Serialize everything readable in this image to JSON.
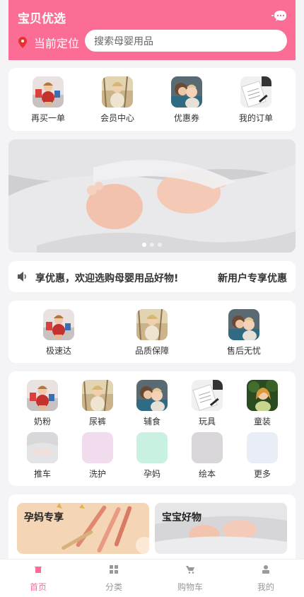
{
  "header": {
    "title": "宝贝优选",
    "location_label": "当前定位",
    "search_placeholder": "搜索母婴用品",
    "message_icon": "chat-bubble-icon",
    "location_icon": "location-pin-icon",
    "color": "#fc6d96"
  },
  "quick_links": [
    {
      "label": "再买一单",
      "icon": "photo-baby-play-icon"
    },
    {
      "label": "会员中心",
      "icon": "photo-child-outdoor-icon"
    },
    {
      "label": "优惠券",
      "icon": "photo-mother-child-icon"
    },
    {
      "label": "我的订单",
      "icon": "photo-notebook-icon"
    }
  ],
  "banner": {
    "image": "baby-feet-photo",
    "slide_count": 3,
    "active_slide": 1
  },
  "notice": {
    "icon": "speaker-icon",
    "text": "享优惠，欢迎选购母婴用品好物!",
    "right_text": "新用户专享优惠"
  },
  "services": [
    {
      "label": "极速达",
      "icon": "photo-baby-play-icon"
    },
    {
      "label": "品质保障",
      "icon": "photo-child-outdoor-icon"
    },
    {
      "label": "售后无忧",
      "icon": "photo-mother-child-icon"
    }
  ],
  "categories": [
    {
      "label": "奶粉",
      "icon": "photo-baby-play-icon"
    },
    {
      "label": "尿裤",
      "icon": "photo-child-outdoor-icon"
    },
    {
      "label": "辅食",
      "icon": "photo-mother-child-icon"
    },
    {
      "label": "玩具",
      "icon": "photo-notebook-icon"
    },
    {
      "label": "童装",
      "icon": "photo-girl-green-icon"
    },
    {
      "label": "推车",
      "icon": "photo-baby-feet-icon"
    },
    {
      "label": "洗护",
      "icon": "placeholder-pink-icon",
      "color": "#f1dced"
    },
    {
      "label": "孕妈",
      "icon": "placeholder-mint-icon",
      "color": "#c9f1e2"
    },
    {
      "label": "绘本",
      "icon": "placeholder-gray-icon",
      "color": "#d8d6d8"
    },
    {
      "label": "更多",
      "icon": "placeholder-blue-icon",
      "color": "#e8edf6"
    }
  ],
  "promos": [
    {
      "title": "孕妈专享",
      "image": "makeup-brushes-photo"
    },
    {
      "title": "宝宝好物",
      "image": "baby-feet-photo"
    }
  ],
  "tabbar": {
    "items": [
      {
        "label": "首页",
        "icon": "home-icon",
        "active": true
      },
      {
        "label": "分类",
        "icon": "grid-icon",
        "active": false
      },
      {
        "label": "购物车",
        "icon": "cart-icon",
        "active": false
      },
      {
        "label": "我的",
        "icon": "user-icon",
        "active": false
      }
    ],
    "active_color": "#fc6d96",
    "inactive_color": "#999999"
  }
}
